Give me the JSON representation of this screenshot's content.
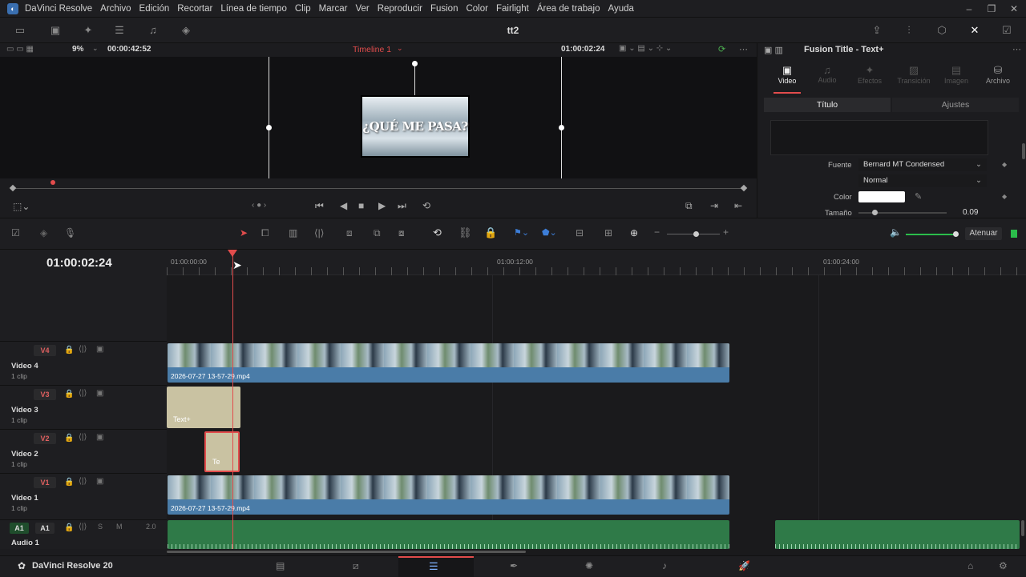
{
  "menubar": {
    "app_name": "DaVinci Resolve",
    "items": [
      "Archivo",
      "Edición",
      "Recortar",
      "Línea de tiempo",
      "Clip",
      "Marcar",
      "Ver",
      "Reproducir",
      "Fusion",
      "Color",
      "Fairlight",
      "Área de trabajo",
      "Ayuda"
    ]
  },
  "toolbar": {
    "project_title": "tt2"
  },
  "viewer": {
    "zoom": "9%",
    "source_timecode": "00:00:42:52",
    "timeline_name": "Timeline 1",
    "record_timecode": "01:00:02:24",
    "title_text": "¿QUÉ ME PASA?"
  },
  "inspector": {
    "title": "Fusion Title - Text+",
    "tabs": [
      "Video",
      "Audio",
      "Efectos",
      "Transición",
      "Imagen",
      "Archivo"
    ],
    "subtabs": [
      "Título",
      "Ajustes"
    ],
    "font_label": "Fuente",
    "font_value": "Bernard MT Condensed",
    "style_value": "Normal",
    "color_label": "Color",
    "size_label": "Tamaño",
    "size_value": "0.09",
    "size_level": 0.09
  },
  "timeline": {
    "current_timecode": "01:00:02:24",
    "ruler": [
      "01:00:00:00",
      "01:00:12:00",
      "01:00:24:00"
    ],
    "volume_label": "Atenuar",
    "tracks": [
      {
        "tag": "V4",
        "name": "Video 4",
        "count": "1 clip"
      },
      {
        "tag": "V3",
        "name": "Video 3",
        "count": "1 clip"
      },
      {
        "tag": "V2",
        "name": "Video 2",
        "count": "1 clip"
      },
      {
        "tag": "V1",
        "name": "Video 1",
        "count": "1 clip"
      }
    ],
    "audio": {
      "tag1": "A1",
      "tag2": "A1",
      "solo": "S",
      "mute": "M",
      "level": "2.0",
      "name": "Audio 1"
    },
    "clips": {
      "v4_name": "2026-07-27 13-57-29.mp4",
      "v3_name": "Text+",
      "v2_name": "Te",
      "v1_name": "2026-07-27 13-57-29.mp4"
    }
  },
  "bottom": {
    "app_label": "DaVinci Resolve 20"
  },
  "colors": {
    "accent_red": "#e24c4c",
    "clip_blue": "#4a7ca8",
    "text_clip": "#c9c2a2",
    "audio_green": "#2f7a48"
  }
}
